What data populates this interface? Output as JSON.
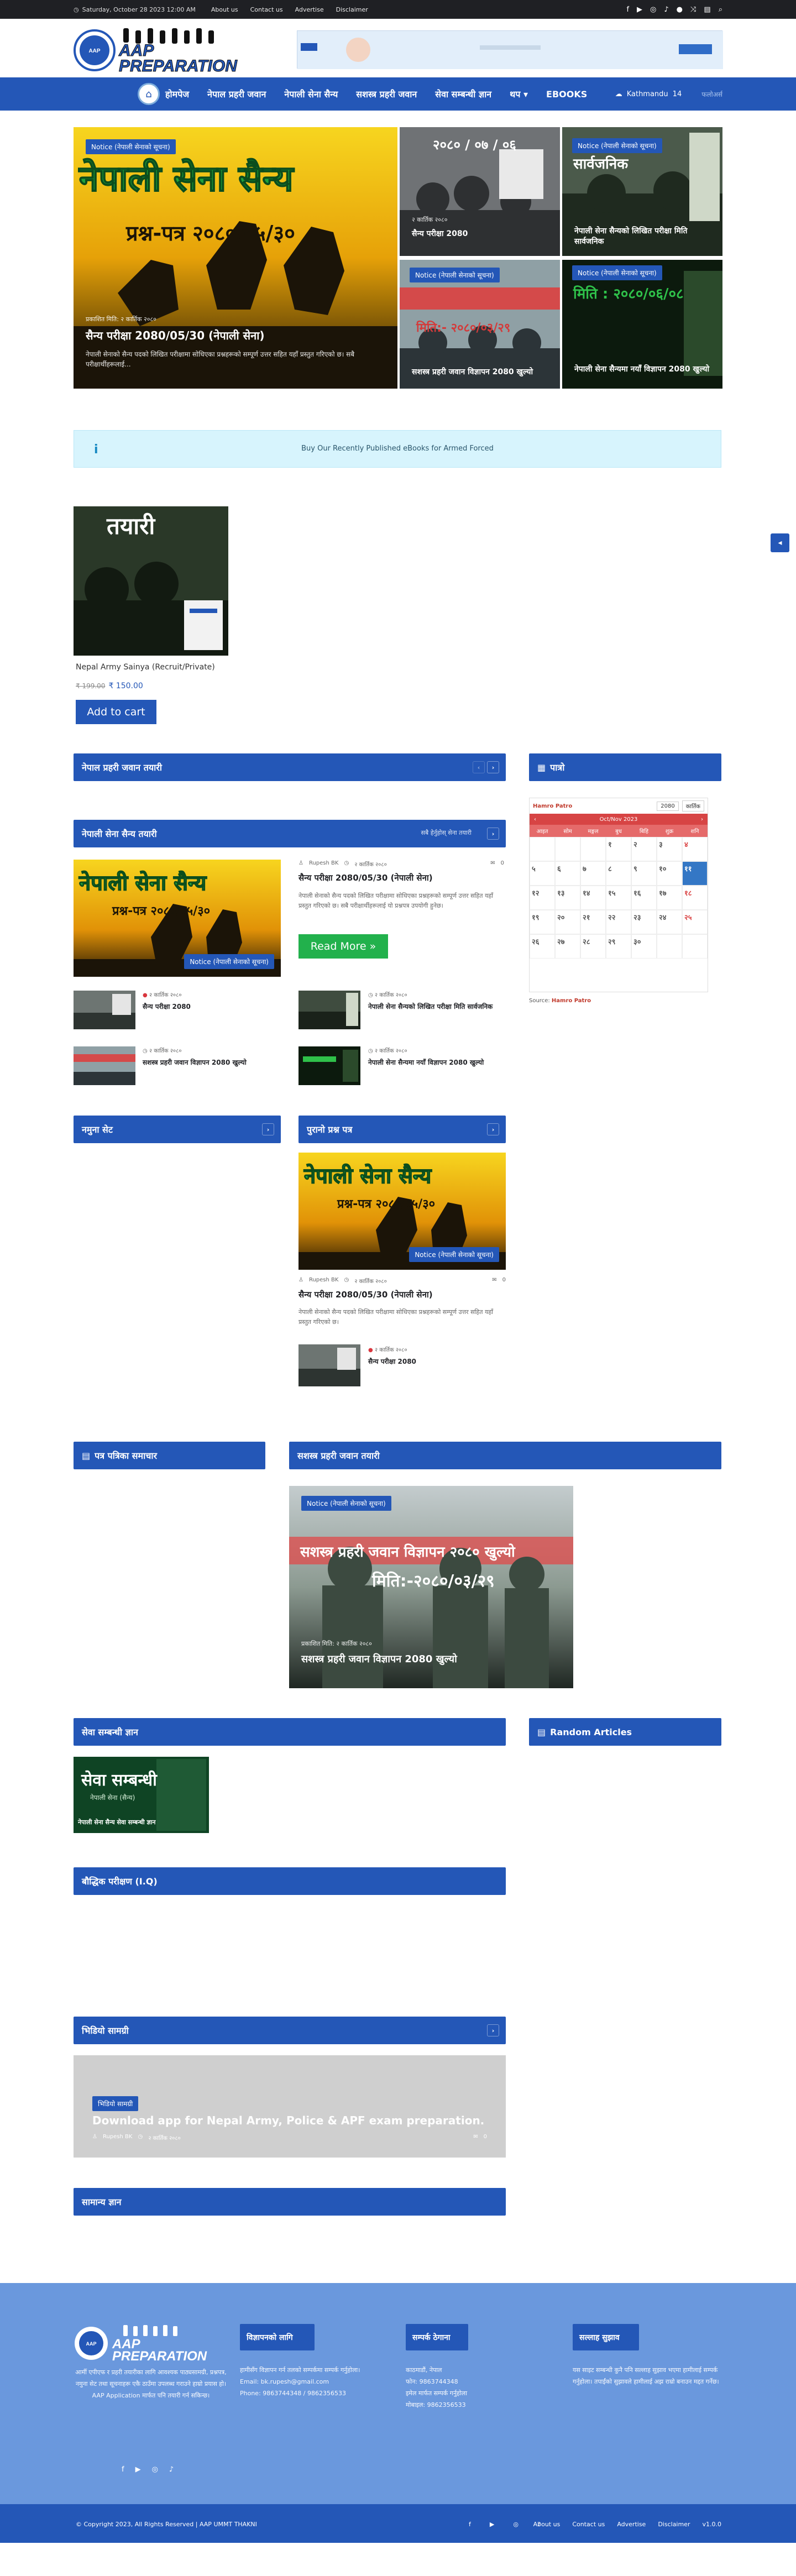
{
  "topbar": {
    "date": "Saturday, October 28 2023 12:00 AM",
    "links": [
      "About us",
      "Contact us",
      "Advertise",
      "Disclaimer"
    ]
  },
  "brand": {
    "logo_top": "AAP",
    "logo_bottom": "PREPARATION",
    "emblem_text": "AAP UMMT"
  },
  "nav": {
    "items": [
      "होमपेज",
      "नेपाल प्रहरी जवान",
      "नेपाली सेना सैन्य",
      "सशस्त्र प्रहरी जवान",
      "सेवा सम्बन्धी ज्ञान",
      "थप",
      "EBOOKS"
    ],
    "weather_city": "Kathmandu",
    "weather_temp": "14",
    "weather_more": "फलोअर्स"
  },
  "hero": {
    "main": {
      "badge": "Notice (नेपाली सेनाको सूचना)",
      "image_text_1": "नेपाली सेना सैन्य",
      "image_text_2": "प्रश्न-पत्र २०८०/०५/३०",
      "meta": "प्रकाशित मिति: २ कार्तिक २०८०",
      "title": "सैन्य परीक्षा 2080/05/30 (नेपाली सेना)",
      "excerpt": "नेपाली सेनाको सैन्य पदको लिखित परीक्षामा सोधिएका प्रश्नहरूको सम्पूर्ण उत्तर सहित यहाँ प्रस्तुत गरिएको छ। सबै परीक्षार्थीहरूलाई..."
    },
    "small": [
      {
        "badge": "",
        "image_text": "२०८० / ०७ / ०६",
        "meta": "२ कार्तिक २०८०",
        "title": "सैन्य परीक्षा 2080"
      },
      {
        "badge": "Notice (नेपाली सेनाको सूचना)",
        "image_text": "सार्वजनिक",
        "meta": "२ कार्तिक २०८०",
        "title": "नेपाली सेना सैन्यको लिखित परीक्षा मिति सार्वजनिक"
      },
      {
        "badge": "Notice (नेपाली सेनाको सूचना)",
        "image_text": "मिति:- २०८०/०३/२९",
        "meta": "",
        "title": "सशस्त्र प्रहरी जवान विज्ञापन 2080 खुल्यो"
      },
      {
        "badge": "Notice (नेपाली सेनाको सूचना)",
        "image_text": "मिति : २०८०/०६/०८",
        "meta": "",
        "title": "नेपाली सेना सैन्यमा नयाँ विज्ञापन 2080 खुल्यो"
      }
    ]
  },
  "info_box": {
    "icon": "i",
    "text": "Buy Our Recently Published eBooks for Armed Forced"
  },
  "product": {
    "image_text": "तयारी",
    "name": "Nepal Army Sainya (Recruit/Private)",
    "old_price": "₹ 199.00",
    "price": "₹ 150.00",
    "cart_label": "Add to cart"
  },
  "sections": {
    "police": "नेपाल प्रहरी जवान तयारी",
    "army": "नेपाली सेना सैन्य तयारी",
    "army_pill": "सबै हेर्नुहोस् सेना तयारी",
    "calendar_title": "पात्रो",
    "model_set": "नमुना सेट",
    "old_papers": "पुरानो प्रश्न पत्र",
    "news": "पत्र पत्रिका समाचार",
    "apf": "सशस्त्र प्रहरी जवान तयारी",
    "service_gk": "सेवा सम्बन्धी ज्ञान",
    "random": "Random Articles",
    "iq": "बौद्धिक परीक्षण (I.Q)",
    "video": "भिडियो सामग्री",
    "general": "सामान्य ज्ञान"
  },
  "army_block": {
    "main_badge": "Notice (नेपाली सेनाको सूचना)",
    "main_image_text_1": "नेपाली सेना सैन्य",
    "main_image_text_2": "प्रश्न-पत्र २०८०/०५/३०",
    "author": "Rupesh BK",
    "date": "२ कार्तिक २०८०",
    "comments": "0",
    "title": "सैन्य परीक्षा 2080/05/30 (नेपाली सेना)",
    "excerpt": "नेपाली सेनाको सैन्य पदको लिखित परीक्षामा सोधिएका प्रश्नहरूको सम्पूर्ण उत्तर सहित यहाँ प्रस्तुत गरिएको छ। सबै परीक्षार्थीहरूलाई यो प्रश्नपत्र उपयोगी हुनेछ।",
    "read_more": "Read More »",
    "list": [
      {
        "meta": "२ कार्तिक २०८०",
        "title": "सैन्य परीक्षा 2080"
      },
      {
        "meta": "२ कार्तिक २०८०",
        "title": "नेपाली सेना सैन्यको लिखित परीक्षा मिति सार्वजनिक"
      },
      {
        "meta": "२ कार्तिक २०८०",
        "title": "सशस्त्र प्रहरी जवान विज्ञापन 2080 खुल्यो"
      },
      {
        "meta": "२ कार्तिक २०८०",
        "title": "नेपाली सेना सैन्यमा नयाँ विज्ञापन 2080 खुल्यो"
      }
    ]
  },
  "old_papers_block": {
    "badge": "Notice (नेपाली सेनाको सूचना)",
    "author": "Rupesh BK",
    "date": "२ कार्तिक २०८०",
    "comments": "0",
    "title": "सैन्य परीक्षा 2080/05/30 (नेपाली सेना)",
    "excerpt": "नेपाली सेनाको सैन्य पदको लिखित परीक्षामा सोधिएका प्रश्नहरूको सम्पूर्ण उत्तर सहित यहाँ प्रस्तुत गरिएको छ।",
    "list_meta": "२ कार्तिक २०८०",
    "list_title": "सैन्य परीक्षा 2080"
  },
  "apf_block": {
    "badge": "Notice (नेपाली सेनाको सूचना)",
    "image_text_1": "सशस्त्र प्रहरी जवान विज्ञापन २०८० खुल्यो",
    "image_text_2": "मिति:-२०८०/०३/२९",
    "meta": "प्रकाशित मिति: २ कार्तिक २०८०",
    "title": "सशस्त्र प्रहरी जवान विज्ञापन 2080 खुल्यो"
  },
  "service_card": {
    "title": "सेवा सम्बन्धी",
    "sub": "नेपाली सेना (सैन्य)",
    "caption": "नेपाली सेना सैन्य सेवा सम्बन्धी ज्ञान"
  },
  "video_block": {
    "badge": "भिडियो सामग्री",
    "title": "Download app for Nepal Army, Police & APF exam preparation.",
    "author": "Rupesh BK",
    "date": "२ कार्तिक २०८०",
    "comments": "0"
  },
  "calendar": {
    "brand": "Hamro Patro",
    "year": "2080",
    "month_np": "कार्तिक",
    "month_en": "Oct/Nov 2023",
    "weekdays": [
      "आइत",
      "सोम",
      "मङ्गल",
      "बुध",
      "बिहि",
      "शुक्र",
      "शनि"
    ],
    "days": [
      "",
      "",
      "",
      "१",
      "२",
      "३",
      "४",
      "५",
      "६",
      "७",
      "८",
      "९",
      "१०",
      "११",
      "१२",
      "१३",
      "१४",
      "१५",
      "१६",
      "१७",
      "१८",
      "१९",
      "२०",
      "२१",
      "२२",
      "२३",
      "२४",
      "२५",
      "२६",
      "२७",
      "२८",
      "२९",
      "३०",
      "",
      ""
    ],
    "today_index": 13,
    "source_prefix": "Source:",
    "source": "Hamro Patro"
  },
  "footer": {
    "about": "आर्मी एपीएफ र प्रहरी तयारीका लागि आवश्यक पाठ्यसामग्री, प्रश्नपत्र, नमुना सेट तथा सूचनाहरू एकै ठाउँमा उपलब्ध गराउने हाम्रो प्रयास हो। AAP Application मार्फत पनि तयारी गर्न सकिन्छ।",
    "col2_title": "विज्ञापनको लागि",
    "col2_lines": [
      "हामीसँग विज्ञापन गर्न तलको सम्पर्कमा सम्पर्क गर्नुहोला।",
      "Email: bk.rupesh@gmail.com",
      "Phone: 9863744348 / 9862356533"
    ],
    "col3_title": "सम्पर्क ठेगाना",
    "col3_lines": [
      "काठमाडौं, नेपाल",
      "फोन: 9863744348",
      "इमेल मार्फत सम्पर्क गर्नुहोला",
      "मोबाइल: 9862356533"
    ],
    "col4_title": "सल्लाह सुझाव",
    "col4_text": "यस साइट सम्बन्धी कुनै पनि सल्लाह सुझाव भएमा हामीलाई सम्पर्क गर्नुहोला। तपाईंको सुझावले हामीलाई अझ राम्रो बनाउन मद्दत गर्नेछ।",
    "copyright": "© Copyright 2023, All Rights Reserved  |  AAP UMMT THAKNI",
    "links": [
      "About us",
      "Contact us",
      "Advertise",
      "Disclaimer"
    ],
    "version": "v1.0.0"
  },
  "colors": {
    "brand_blue": "#2457b7",
    "topbar": "#1f2024",
    "footer": "#6a98dd",
    "read_more_green": "#22b14c"
  }
}
